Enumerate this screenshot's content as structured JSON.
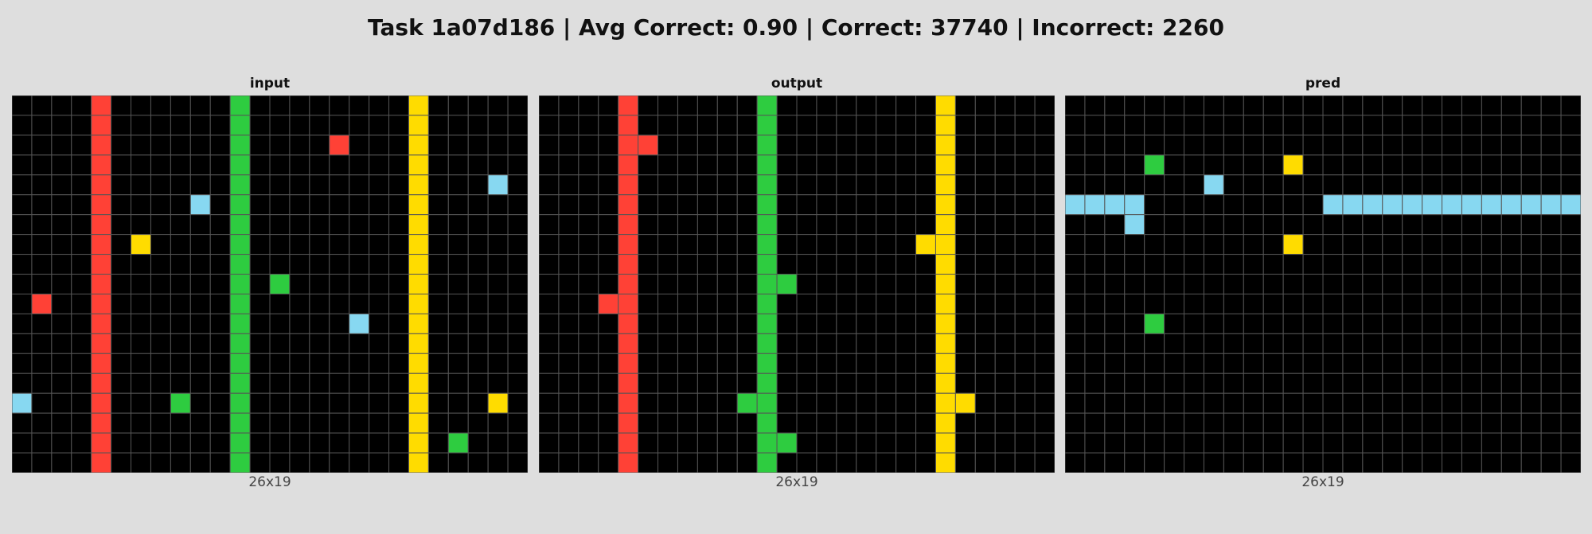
{
  "title": "Task 1a07d186 | Avg Correct: 0.90 | Correct: 37740 | Incorrect: 2260",
  "palette": {
    "0": "#000000",
    "2": "#ff4136",
    "3": "#2ecc40",
    "4": "#ffdc00",
    "8": "#87d8f1"
  },
  "grid_line_color": "#555555",
  "panels": [
    {
      "title": "input",
      "caption": "26x19",
      "width": 26,
      "height": 19,
      "bars": [
        {
          "col": 4,
          "color": 2
        },
        {
          "col": 11,
          "color": 3
        },
        {
          "col": 20,
          "color": 4
        }
      ],
      "cells": [
        [
          2,
          16,
          2
        ],
        [
          4,
          24,
          8
        ],
        [
          5,
          9,
          8
        ],
        [
          7,
          6,
          4
        ],
        [
          9,
          13,
          3
        ],
        [
          10,
          1,
          2
        ],
        [
          11,
          17,
          8
        ],
        [
          15,
          0,
          8
        ],
        [
          15,
          8,
          3
        ],
        [
          15,
          24,
          4
        ],
        [
          17,
          22,
          3
        ]
      ]
    },
    {
      "title": "output",
      "caption": "26x19",
      "width": 26,
      "height": 19,
      "bars": [
        {
          "col": 4,
          "color": 2
        },
        {
          "col": 11,
          "color": 3
        },
        {
          "col": 20,
          "color": 4
        }
      ],
      "cells": [
        [
          2,
          5,
          2
        ],
        [
          7,
          19,
          4
        ],
        [
          9,
          12,
          3
        ],
        [
          10,
          3,
          2
        ],
        [
          15,
          10,
          3
        ],
        [
          15,
          21,
          4
        ],
        [
          17,
          12,
          3
        ]
      ]
    },
    {
      "title": "pred",
      "caption": "26x19",
      "width": 26,
      "height": 19,
      "bars": [],
      "cells": [
        [
          3,
          4,
          3
        ],
        [
          3,
          11,
          4
        ],
        [
          4,
          7,
          8
        ],
        [
          5,
          0,
          8
        ],
        [
          5,
          1,
          8
        ],
        [
          5,
          2,
          8
        ],
        [
          5,
          3,
          8
        ],
        [
          5,
          13,
          8
        ],
        [
          5,
          14,
          8
        ],
        [
          5,
          15,
          8
        ],
        [
          5,
          16,
          8
        ],
        [
          5,
          17,
          8
        ],
        [
          5,
          18,
          8
        ],
        [
          5,
          19,
          8
        ],
        [
          5,
          20,
          8
        ],
        [
          5,
          21,
          8
        ],
        [
          5,
          22,
          8
        ],
        [
          5,
          23,
          8
        ],
        [
          5,
          24,
          8
        ],
        [
          5,
          25,
          8
        ],
        [
          6,
          3,
          8
        ],
        [
          7,
          11,
          4
        ],
        [
          11,
          4,
          3
        ]
      ]
    }
  ]
}
